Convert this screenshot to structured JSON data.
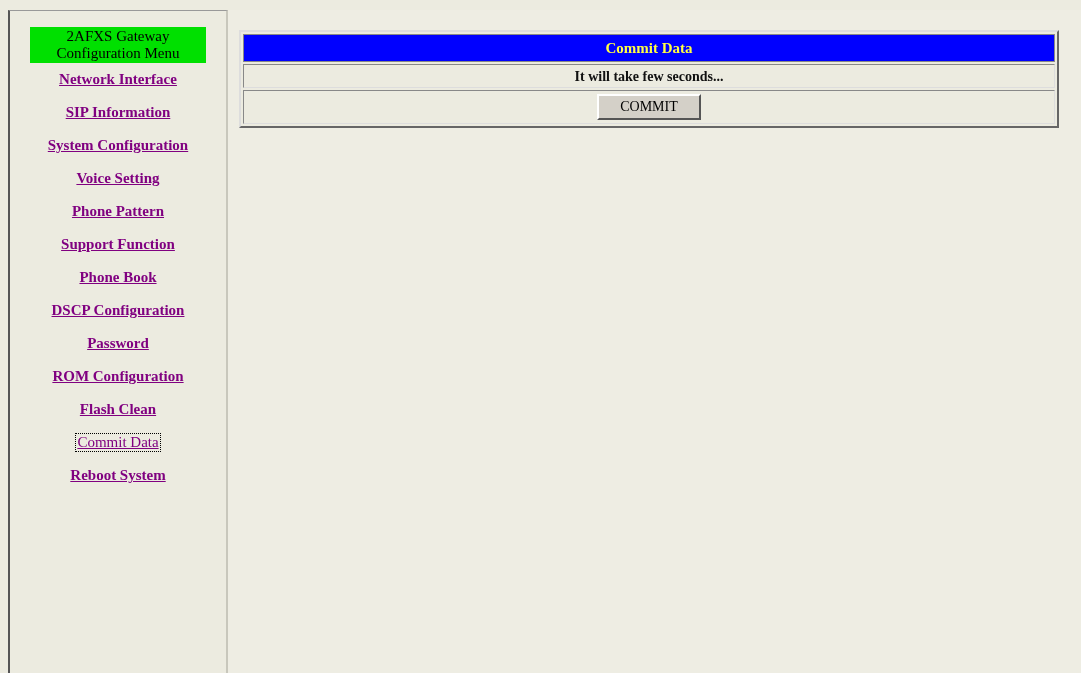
{
  "menu": {
    "title": "2AFXS Gateway Configuration Menu",
    "items": [
      {
        "label": "Network Interface",
        "selected": false
      },
      {
        "label": "SIP Information",
        "selected": false
      },
      {
        "label": "System Configuration",
        "selected": false
      },
      {
        "label": "Voice Setting",
        "selected": false
      },
      {
        "label": "Phone Pattern",
        "selected": false
      },
      {
        "label": "Support Function",
        "selected": false
      },
      {
        "label": "Phone Book",
        "selected": false
      },
      {
        "label": "DSCP Configuration",
        "selected": false
      },
      {
        "label": "Password",
        "selected": false
      },
      {
        "label": "ROM Configuration",
        "selected": false
      },
      {
        "label": "Flash Clean",
        "selected": false
      },
      {
        "label": "Commit Data",
        "selected": true
      },
      {
        "label": "Reboot System",
        "selected": false
      }
    ]
  },
  "panel": {
    "title": "Commit Data",
    "message": "It will take few seconds...",
    "button": "COMMIT"
  }
}
